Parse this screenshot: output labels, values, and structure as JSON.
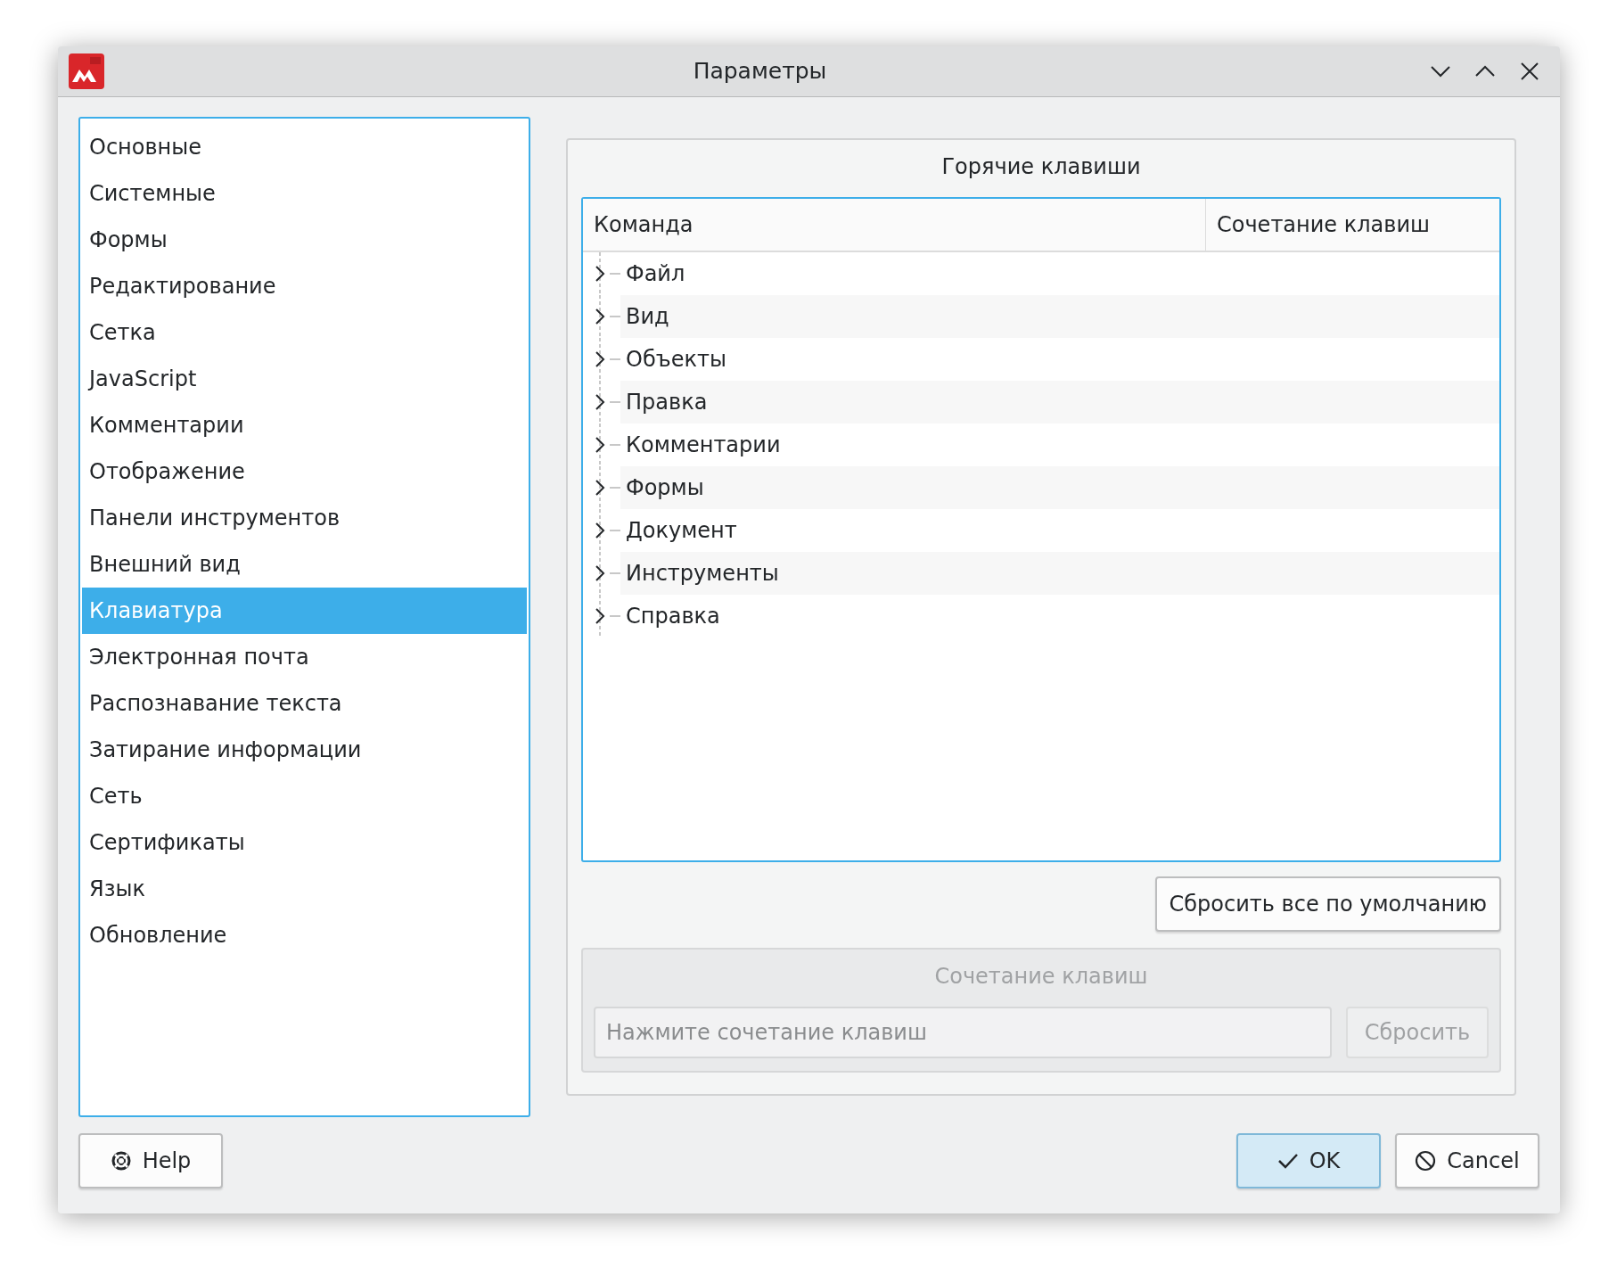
{
  "window": {
    "title": "Параметры"
  },
  "sidebar": {
    "items": [
      {
        "label": "Основные",
        "selected": false
      },
      {
        "label": "Системные",
        "selected": false
      },
      {
        "label": "Формы",
        "selected": false
      },
      {
        "label": "Редактирование",
        "selected": false
      },
      {
        "label": "Сетка",
        "selected": false
      },
      {
        "label": "JavaScript",
        "selected": false
      },
      {
        "label": "Комментарии",
        "selected": false
      },
      {
        "label": "Отображение",
        "selected": false
      },
      {
        "label": "Панели инструментов",
        "selected": false
      },
      {
        "label": "Внешний вид",
        "selected": false
      },
      {
        "label": "Клавиатура",
        "selected": true
      },
      {
        "label": "Электронная почта",
        "selected": false
      },
      {
        "label": "Распознавание текста",
        "selected": false
      },
      {
        "label": "Затирание информации",
        "selected": false
      },
      {
        "label": "Сеть",
        "selected": false
      },
      {
        "label": "Сертификаты",
        "selected": false
      },
      {
        "label": "Язык",
        "selected": false
      },
      {
        "label": "Обновление",
        "selected": false
      }
    ]
  },
  "hotkeys": {
    "title": "Горячие клавиши",
    "tree": {
      "columns": [
        "Команда",
        "Сочетание клавиш"
      ],
      "rows": [
        {
          "label": "Файл",
          "expanded": false
        },
        {
          "label": "Вид",
          "expanded": false
        },
        {
          "label": "Объекты",
          "expanded": false
        },
        {
          "label": "Правка",
          "expanded": false
        },
        {
          "label": "Комментарии",
          "expanded": false
        },
        {
          "label": "Формы",
          "expanded": false
        },
        {
          "label": "Документ",
          "expanded": false
        },
        {
          "label": "Инструменты",
          "expanded": false
        },
        {
          "label": "Справка",
          "expanded": false
        }
      ]
    },
    "reset_all_button": "Сбросить все по умолчанию",
    "shortcut": {
      "title": "Сочетание клавиш",
      "placeholder": "Нажмите сочетание клавиш",
      "reset_button": "Сбросить",
      "disabled": true
    }
  },
  "buttons": [
    {
      "kind": "help",
      "label": "Help",
      "default": false
    },
    {
      "kind": "ok",
      "label": "OK",
      "default": true
    },
    {
      "kind": "cancel",
      "label": "Cancel",
      "default": false
    }
  ]
}
